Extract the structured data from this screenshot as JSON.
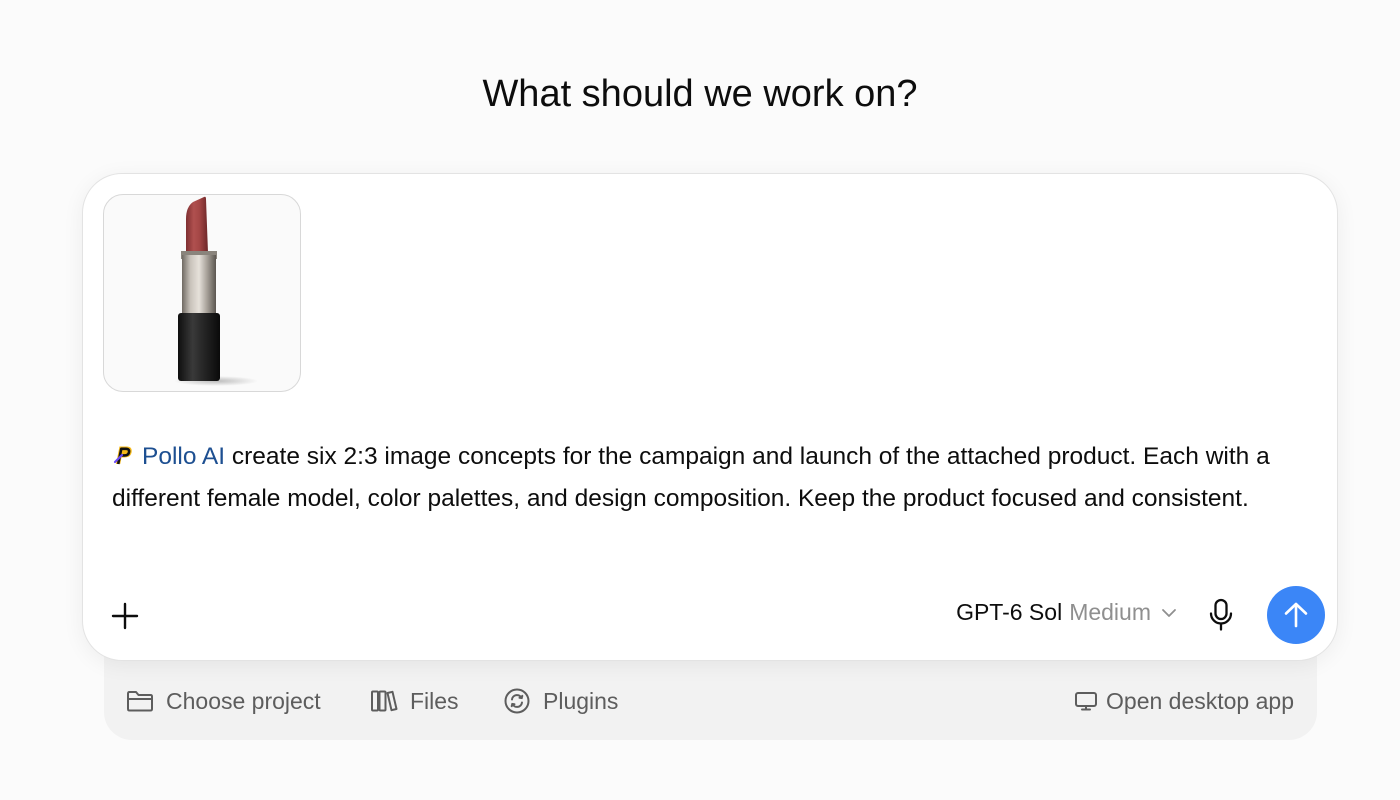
{
  "page": {
    "title": "What should we work on?"
  },
  "composer": {
    "attachment_icon": "lipstick-product-image",
    "mention": {
      "icon": "pollo-ai-logo-icon",
      "name": "Pollo AI"
    },
    "prompt_text": " create six 2:3 image concepts for the campaign and launch of the attached product. Each with a different female model, color palettes, and design composition. Keep the product focused and consistent.",
    "add_icon": "plus-icon",
    "model": {
      "name": "GPT-6 Sol",
      "effort": "Medium",
      "chevron_icon": "chevron-down-icon"
    },
    "mic_icon": "microphone-icon",
    "send_icon": "arrow-up-icon"
  },
  "footer": {
    "choose_project": "Choose project",
    "files": "Files",
    "plugins": "Plugins",
    "open_desktop_app": "Open desktop app"
  },
  "colors": {
    "accent": "#3b86f7",
    "mention": "#1d4f91",
    "background": "#fbfbfb",
    "tray": "#f2f2f2"
  }
}
